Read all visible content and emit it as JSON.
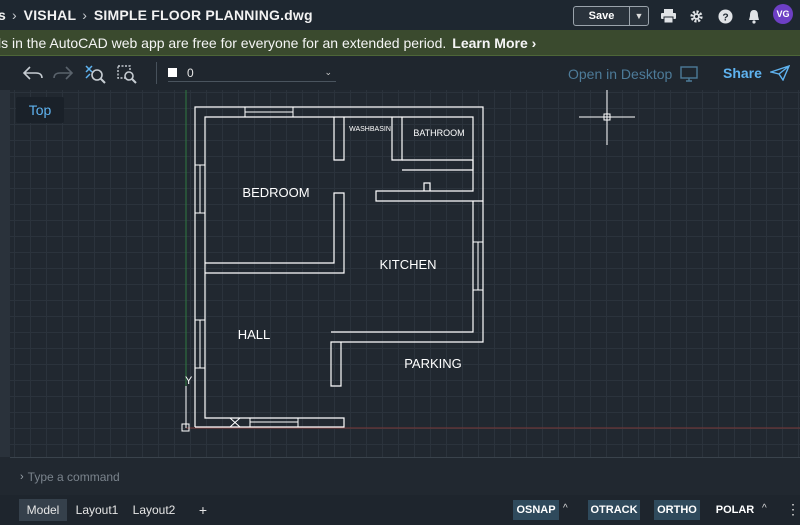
{
  "breadcrumb": {
    "prefix": "s",
    "folder": "VISHAL",
    "file": "SIMPLE FLOOR PLANNING.dwg"
  },
  "header": {
    "save_label": "Save",
    "avatar_initials": "VG"
  },
  "banner": {
    "message": "ls in the AutoCAD web app are free for everyone for an extended period.",
    "link": "Learn More ›"
  },
  "toolbar": {
    "layer_name": "0",
    "open_desktop": "Open in Desktop",
    "share": "Share"
  },
  "canvas": {
    "view_label": "Top",
    "ucs_y_label": "Y",
    "rooms": {
      "bedroom": "BEDROOM",
      "kitchen": "KITCHEN",
      "hall": "HALL",
      "parking": "PARKING",
      "washbasin": "WASHBASIN",
      "bathroom": "BATHROOM"
    }
  },
  "command": {
    "placeholder": "Type a command"
  },
  "status": {
    "tabs": [
      "Model",
      "Layout1",
      "Layout2"
    ],
    "add_tab": "+",
    "modes": [
      "OSNAP",
      "OTRACK",
      "ORTHO",
      "POLAR"
    ],
    "more": "⋮"
  },
  "colors": {
    "accent": "#5fb3f0",
    "banner": "#3a4a2e",
    "avatar": "#6d3fc4"
  }
}
